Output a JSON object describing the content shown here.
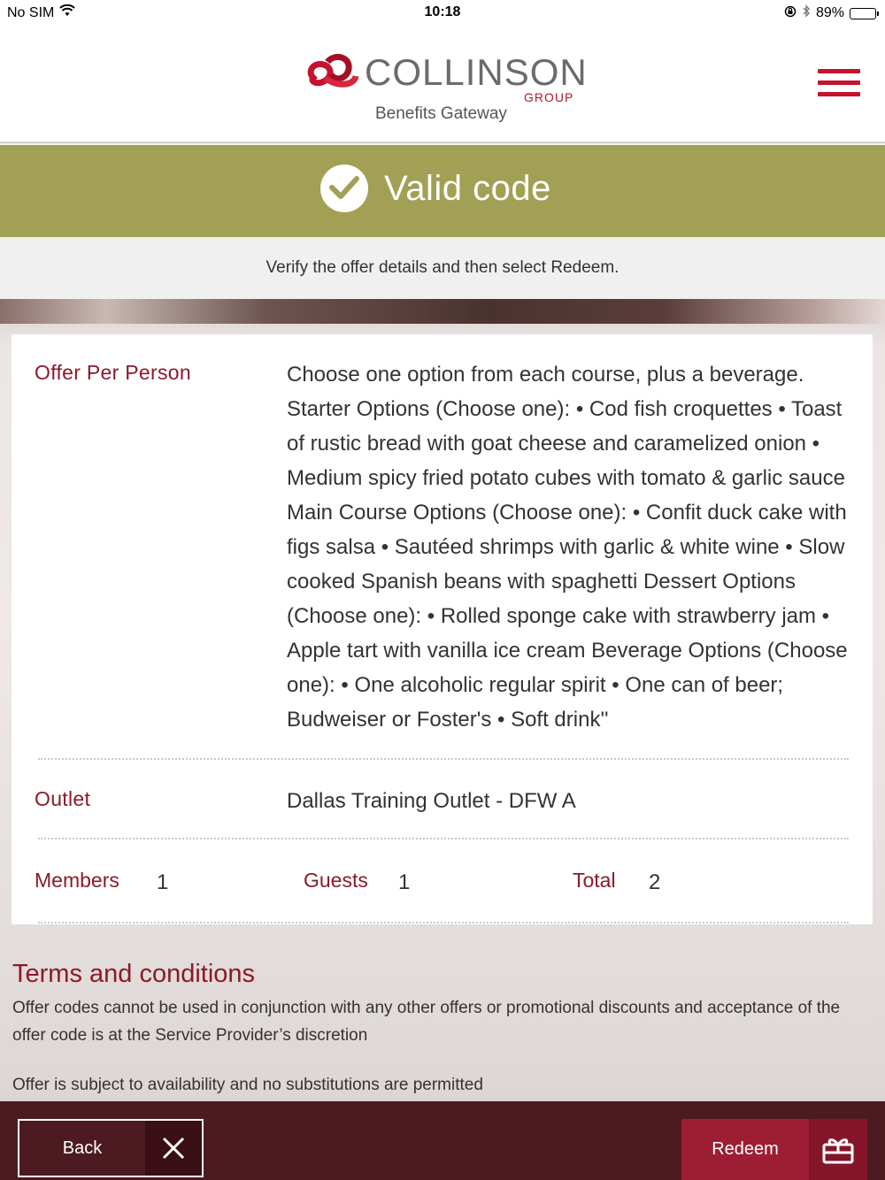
{
  "status_bar": {
    "carrier": "No SIM",
    "time": "10:18",
    "battery_percent": "89%",
    "battery_level": 0.89
  },
  "header": {
    "brand": "COLLINSON",
    "brand_group": "GROUP",
    "subtitle": "Benefits Gateway",
    "accent_color": "#c4122f"
  },
  "banner": {
    "title": "Valid code",
    "background_color": "#a1a055"
  },
  "instruction": "Verify the offer details and then select Redeem.",
  "offer": {
    "label": "Offer Per Person",
    "description": "Choose one option from each course, plus a beverage. Starter Options (Choose one): • Cod fish croquettes • Toast of rustic bread with goat cheese and caramelized onion • Medium spicy fried potato cubes with tomato & garlic sauce Main Course Options (Choose one): • Confit duck cake with figs salsa • Sautéed shrimps with garlic & white wine • Slow cooked Spanish beans with spaghetti Dessert Options (Choose one): • Rolled sponge cake with strawberry jam • Apple tart with vanilla ice cream Beverage Options (Choose one): • One alcoholic regular spirit • One can of beer; Budweiser or Foster's • Soft drink''"
  },
  "outlet": {
    "label": "Outlet",
    "value": "Dallas Training Outlet - DFW A"
  },
  "counts": {
    "members_label": "Members",
    "members_value": "1",
    "guests_label": "Guests",
    "guests_value": "1",
    "total_label": "Total",
    "total_value": "2"
  },
  "terms": {
    "title": "Terms and conditions",
    "paragraph_1": "Offer codes cannot be used in conjunction with any other offers or promotional discounts and acceptance of the offer code is at the Service Provider’s discretion",
    "paragraph_2": "Offer is subject to availability and no substitutions are permitted"
  },
  "footer": {
    "back_label": "Back",
    "redeem_label": "Redeem"
  }
}
